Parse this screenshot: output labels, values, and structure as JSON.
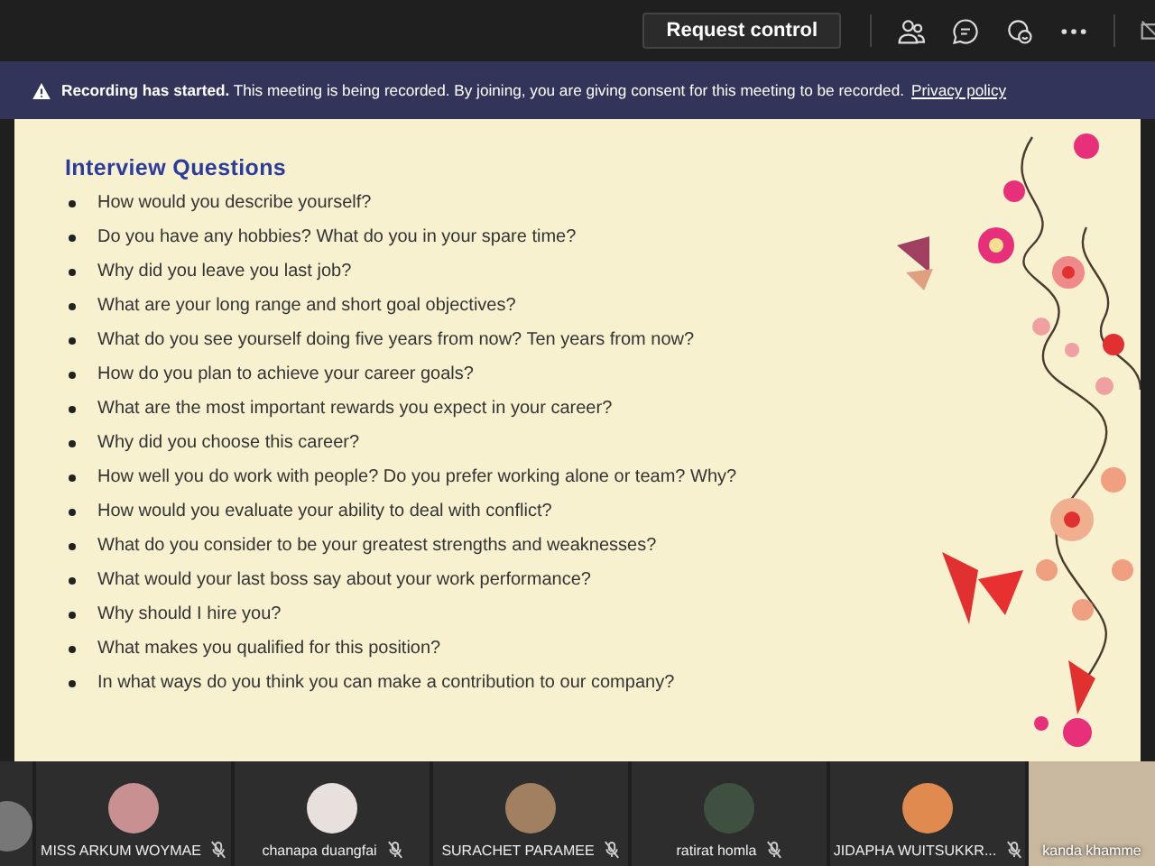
{
  "toolbar": {
    "request_button": "Request control"
  },
  "banner": {
    "text": "**Recording has started.** This meeting is being recorded. By joining, you are giving consent for this meeting to be recorded.",
    "link": "Privacy policy"
  },
  "slide": {
    "title": "Interview Questions",
    "questions": [
      "How would you describe yourself?",
      "Do you have any hobbies? What do you in your spare time?",
      "Why did you leave you last job?",
      "What are your long range and short goal objectives?",
      "What do you see yourself doing five years from now? Ten years from now?",
      "How do you plan to achieve your career goals?",
      "What are the most important rewards you expect in your career?",
      "Why did you choose this career?",
      "How well you do work with people? Do you prefer working alone or team? Why?",
      "How would you evaluate your ability to deal with conflict?",
      "What do you consider to be your greatest strengths and weaknesses?",
      "What would your last boss say about your work performance?",
      "Why should I hire you?",
      "What makes you qualified for this position?",
      "In what ways do you think you can make a contribution to our company?"
    ]
  },
  "participants": [
    {
      "name": "MISS ARKUM WOYMAE",
      "muted": true
    },
    {
      "name": "chanapa duangfai",
      "muted": true
    },
    {
      "name": "SURACHET PARAMEE",
      "muted": true
    },
    {
      "name": "ratirat homla",
      "muted": true
    },
    {
      "name": "JIDAPHA WUITSUKKR...",
      "muted": true
    }
  ],
  "video_tile": {
    "name": "kanda khamme"
  }
}
